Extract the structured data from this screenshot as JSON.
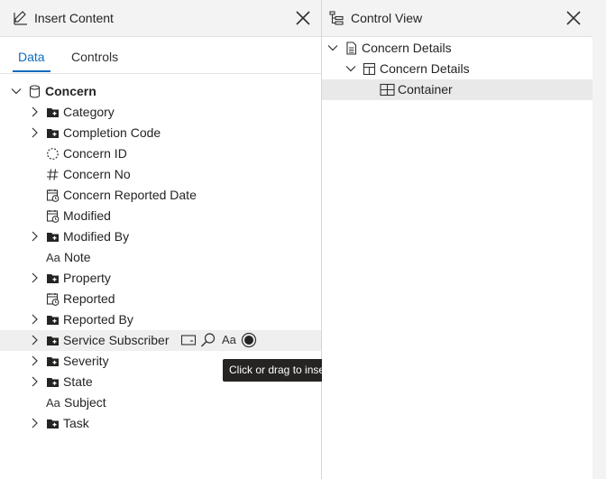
{
  "left_panel": {
    "title": "Insert Content",
    "tabs": [
      {
        "label": "Data",
        "active": true
      },
      {
        "label": "Controls",
        "active": false
      }
    ],
    "tree_root": "Concern",
    "items": [
      {
        "label": "Category",
        "icon": "folder-plus-icon",
        "expandable": true
      },
      {
        "label": "Completion Code",
        "icon": "folder-plus-icon",
        "expandable": true
      },
      {
        "label": "Concern ID",
        "icon": "dashed-circle-icon",
        "expandable": false
      },
      {
        "label": "Concern No",
        "icon": "hash-icon",
        "expandable": false
      },
      {
        "label": "Concern Reported Date",
        "icon": "calendar-clock-icon",
        "expandable": false
      },
      {
        "label": "Modified",
        "icon": "calendar-clock-icon",
        "expandable": false
      },
      {
        "label": "Modified By",
        "icon": "folder-plus-icon",
        "expandable": true
      },
      {
        "label": "Note",
        "icon": "text-aa-icon",
        "expandable": false
      },
      {
        "label": "Property",
        "icon": "folder-plus-icon",
        "expandable": true
      },
      {
        "label": "Reported",
        "icon": "calendar-clock-icon",
        "expandable": false
      },
      {
        "label": "Reported By",
        "icon": "folder-plus-icon",
        "expandable": true
      },
      {
        "label": "Service Subscriber",
        "icon": "folder-plus-icon",
        "expandable": true
      },
      {
        "label": "Severity",
        "icon": "folder-plus-icon",
        "expandable": true
      },
      {
        "label": "State",
        "icon": "folder-plus-icon",
        "expandable": true
      },
      {
        "label": "Subject",
        "icon": "text-aa-icon",
        "expandable": false
      },
      {
        "label": "Task",
        "icon": "folder-plus-icon",
        "expandable": true
      }
    ],
    "hovered_item": "Service Subscriber",
    "inline_action_icons": [
      "card-icon",
      "lookup-icon",
      "text-aa-icon",
      "radio-icon"
    ],
    "inline_text_label": "Aa",
    "tooltip": "Click or drag to insert Lookup"
  },
  "right_panel": {
    "title": "Control View",
    "tree": [
      {
        "label": "Concern Details",
        "icon": "document-icon",
        "level": 0
      },
      {
        "label": "Concern Details",
        "icon": "section-icon",
        "level": 1
      },
      {
        "label": "Container",
        "icon": "container-icon",
        "level": 2,
        "selected": true
      }
    ]
  },
  "colors": {
    "accent": "#0f6cbd",
    "header_bg": "#f3f3f3",
    "hover_bg": "#efefef",
    "tooltip_bg": "#252423"
  }
}
